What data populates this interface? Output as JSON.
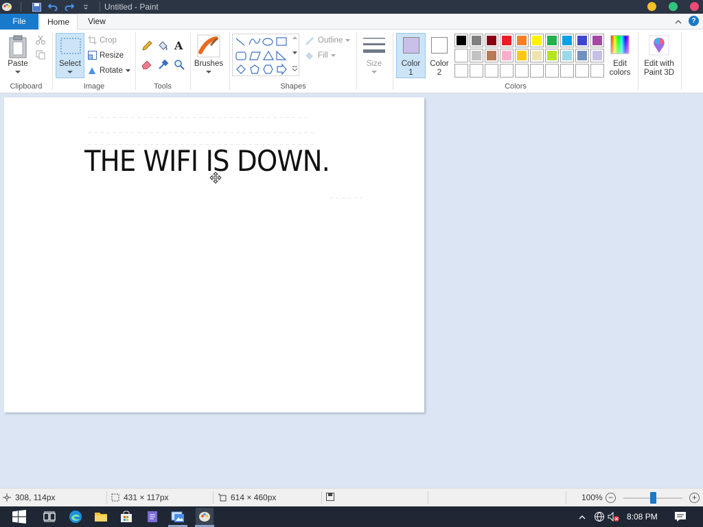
{
  "window": {
    "title": "Untitled - Paint"
  },
  "colors": {
    "accent": "#1979ca",
    "titlebar": "#2b3544",
    "workspace": "#dbe5f3",
    "selected_color1": "#c8c0e8"
  },
  "tabs": {
    "file": "File",
    "home": "Home",
    "view": "View"
  },
  "ribbon": {
    "clipboard": {
      "paste": "Paste",
      "group": "Clipboard"
    },
    "image": {
      "select": "Select",
      "crop": "Crop",
      "resize": "Resize",
      "rotate": "Rotate",
      "group": "Image"
    },
    "tools": {
      "group": "Tools"
    },
    "brushes": {
      "label": "Brushes"
    },
    "shapes": {
      "outline": "Outline",
      "fill": "Fill",
      "group": "Shapes"
    },
    "size": {
      "label": "Size"
    },
    "colors": {
      "color1": "Color",
      "color1_num": "1",
      "color2": "Color",
      "color2_num": "2",
      "edit": "Edit",
      "edit2": "colors",
      "group": "Colors",
      "palette": [
        "#000000",
        "#7f7f7f",
        "#880015",
        "#ed1c24",
        "#ff7f27",
        "#fff200",
        "#22b14c",
        "#00a2e8",
        "#3f48cc",
        "#a349a4",
        "#ffffff",
        "#c3c3c3",
        "#b97a57",
        "#ffaec9",
        "#ffc90e",
        "#efe4b0",
        "#b5e61d",
        "#99d9ea",
        "#7092be",
        "#c8bfe7",
        "#ffffff",
        "#ffffff",
        "#ffffff",
        "#ffffff",
        "#ffffff",
        "#ffffff",
        "#ffffff",
        "#ffffff",
        "#ffffff",
        "#ffffff"
      ]
    },
    "paint3d": {
      "line1": "Edit with",
      "line2": "Paint 3D"
    }
  },
  "canvas": {
    "text": "THE WIFI IS DOWN."
  },
  "status": {
    "cursor_pos": "308, 114px",
    "selection_size": "431 × 117px",
    "canvas_size": "614 × 460px",
    "zoom": "100%",
    "zoom_level_fraction": 0.5
  },
  "taskbar": {
    "time": "8:08 PM"
  }
}
